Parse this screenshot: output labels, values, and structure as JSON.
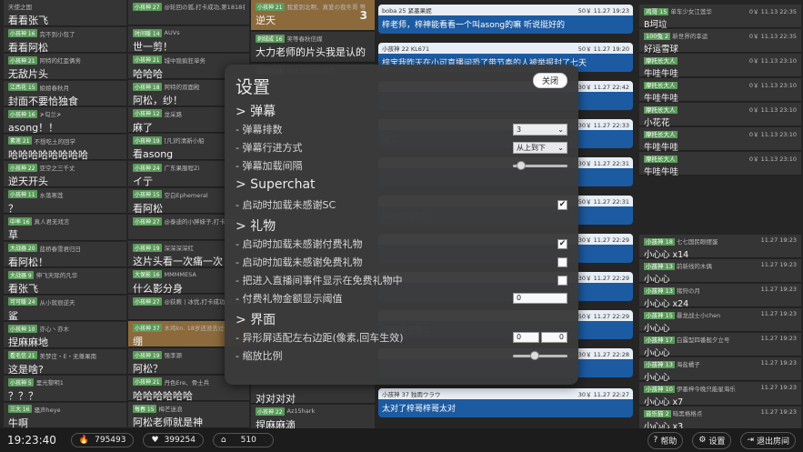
{
  "col1": [
    {
      "u": "天使之国",
      "t": "看看张飞"
    },
    {
      "u": "完不到小包了",
      "b": "小孩神 16",
      "t": "看看阿松"
    },
    {
      "u": "阿特的红歪俩务",
      "b": "小孩神 21",
      "t": "无敌片头"
    },
    {
      "u": "娘娘春秋月",
      "b": "江西花 15",
      "t": "封面不要恰独食"
    },
    {
      "u": "≯勾兰≯",
      "b": "小孩神 16",
      "t": "asong！！"
    },
    {
      "u": "不想吃土的回学",
      "b": "素莲 21",
      "t": "哈哈哈哈哈哈哈哈"
    },
    {
      "u": "亚空之三千丈",
      "b": "小孩神 22",
      "t": "逆天开头"
    },
    {
      "u": "水落寒莲",
      "b": "小孩神 11",
      "t": "？"
    },
    {
      "u": "真人君无戏言",
      "b": "中率 16",
      "t": "草"
    },
    {
      "u": "蓝桥春雪君归日",
      "b": "大战器 20",
      "t": "看阿松！"
    },
    {
      "u": "伸飞天际的凡华",
      "b": "大战器 9",
      "t": "看张飞"
    },
    {
      "u": "从小就很逆天",
      "b": "可可暖 24",
      "t": "鲨"
    },
    {
      "u": "亦心丶亦木",
      "b": "小孩神 10",
      "t": "捏麻麻地"
    },
    {
      "u": "美梦庄・E・无尊果南",
      "b": "看毛信 21",
      "t": "这是啥?"
    },
    {
      "u": "里光黎明1",
      "b": "小孩神 5",
      "t": "？？？"
    },
    {
      "u": "骚声heye",
      "b": "三大 16",
      "t": "牛啊"
    }
  ],
  "col2": [
    {
      "u": "@轮回の狐,打卡成功,第1818名,累计打卡57天",
      "b": "小孩神 27",
      "t": ""
    },
    {
      "u": "AUVs",
      "b": "时间暖 14",
      "t": "世一剪！"
    },
    {
      "u": "城中隐疯狂单务",
      "b": "小孩神 21",
      "t": "哈哈哈"
    },
    {
      "u": "阿特的双面殿",
      "b": "小孩神 18",
      "t": "阿松，纱！"
    },
    {
      "u": "龙采路",
      "b": "小孩神 12",
      "t": "麻了"
    },
    {
      "u": "[凡]的清新小船",
      "b": "小孩神 19",
      "t": "看asong"
    },
    {
      "u": "广东果服程Zi",
      "b": "小孩神 24",
      "t": "イ亍"
    },
    {
      "u": "空白Ephemeral",
      "b": "小孩神 15",
      "t": "看阿松"
    },
    {
      "u": "@泰迪的小胖妹子,打卡成功,第1821名,累计打卡",
      "b": "小孩神 27",
      "t": ""
    },
    {
      "u": "深深深深红",
      "b": "小孩神 19",
      "t": "这片头看一次痛一次"
    },
    {
      "u": "MMMMESA",
      "b": "大保影 16",
      "t": "什么影分身"
    },
    {
      "u": "@荻蕨 | 冰优,打卡成功,第1814名,累计",
      "b": "小孩神 27",
      "t": ""
    },
    {
      "u": "木鸡kn. 18岁还没去过北京",
      "b": "小孩神 37",
      "t": "绷",
      "hl": true
    },
    {
      "u": "强李源",
      "b": "小孩神 19",
      "t": "阿松？"
    },
    {
      "u": "丹色Ere、骨士兵",
      "b": "小孩神 21",
      "t": "哈哈哈哈哈哈"
    },
    {
      "u": "梅芒迷浪",
      "b": "每春 15",
      "t": "阿松老师就是神"
    }
  ],
  "col3": [
    {
      "u": "我爱到北啊、真爱の我冬哥 等",
      "b": "小孩神 21",
      "t": "逆天",
      "hl": true,
      "badge": "3"
    },
    {
      "u": "笑等春秋信媒",
      "b": "刺绒成 16",
      "t": "大力老师的片头我是认的"
    },
    {
      "u": "晚晚怎么这么换币",
      "b": "直乐兰 21",
      "t": ""
    }
  ],
  "col3b": [
    {
      "u": "",
      "b": "",
      "t": "对对对对"
    },
    {
      "u": "Az15hark",
      "b": "小孩神 22",
      "t": "捏麻麻滴"
    }
  ],
  "sc": [
    {
      "name": "boba 25 紧墨果妮",
      "price": "50￥ 11.27 19:23",
      "msg": "梓老师，梓神能看看一个叫asong的嘛 听说挺好的"
    },
    {
      "name": "小孩神 22 KL671",
      "price": "50￥ 11.27 19:20",
      "msg": "梓宝我昨天在小可直播间恐了带节奏的人被举报封了七天"
    },
    {
      "name": "",
      "price": "30￥ 11.27 22:42",
      "msg": ""
    },
    {
      "name": "",
      "price": "30￥ 11.27 22:33",
      "msg": "谢了"
    },
    {
      "name": "",
      "price": "30￥ 11.27 22:31",
      "msg": ""
    },
    {
      "name": "",
      "price": "50￥ 11.27 22:31",
      "msg": "玩dnf的时光"
    },
    {
      "name": "",
      "price": "30￥ 11.27 22:29",
      "msg": ""
    },
    {
      "name": "",
      "price": "30￥ 11.27 22:29",
      "msg": ""
    },
    {
      "name": "",
      "price": "50￥ 11.27 22:29",
      "msg": "你脑袋也瞎么"
    },
    {
      "name": "",
      "price": "30￥ 11.27 22:28",
      "msg": ""
    },
    {
      "name": "小孩神 37 独雨ウラウ",
      "price": "30￥ 11.27 22:27",
      "msg": "太对了梓哥梓哥太对"
    }
  ],
  "gifts_top": [
    {
      "u": "单车少女江莲华",
      "b": "鸡哥 15",
      "time": "0￥ 11.13 22:35",
      "t": "B坷垃"
    },
    {
      "u": "新世界的幸运",
      "b": "100兔 2",
      "time": "0￥ 11.13 22:35",
      "t": "好运雪球"
    },
    {
      "u": "",
      "b": "摩托长大人",
      "time": "0￥ 11.13 23:10",
      "t": "牛哇牛哇"
    },
    {
      "u": "",
      "b": "摩托长大人",
      "time": "0￥ 11.13 23:10",
      "t": "牛哇牛哇"
    },
    {
      "u": "",
      "b": "摩托长大人",
      "time": "0￥ 11.13 23:10",
      "t": "小花花"
    },
    {
      "u": "",
      "b": "摩托长大人",
      "time": "0￥ 11.13 23:10",
      "t": "牛哇牛哇"
    },
    {
      "u": "",
      "b": "摩托长大人",
      "time": "0￥ 11.13 23:10",
      "t": "牛哇牛哇"
    }
  ],
  "gifts_bottom": [
    {
      "u": "七七国民眼摆蛋",
      "b": "小孩神 18",
      "time": "11.27 19:23",
      "t": "小心心 x14"
    },
    {
      "u": "前新线的木偶",
      "b": "小孩神 13",
      "time": "11.27 19:23",
      "t": "小心心"
    },
    {
      "u": "猪狩の月",
      "b": "小孩神 13",
      "time": "11.27 19:23",
      "t": "小心心 x24"
    },
    {
      "u": "暴龙战士小chen",
      "b": "小孩神 15",
      "time": "11.27 19:23",
      "t": "小心心"
    },
    {
      "u": "白露型四番舰夕立号",
      "b": "小孩神 17",
      "time": "11.27 19:23",
      "t": "小心心"
    },
    {
      "u": "海盐橘子",
      "b": "小孩神 13",
      "time": "11.27 19:23",
      "t": "小心心"
    },
    {
      "u": "伊墨梓今晚只能星海乐",
      "b": "小孩神 10",
      "time": "11.27 19:23",
      "t": "小心心 x7"
    },
    {
      "u": "暗黑格格点",
      "b": "音乐猫 2",
      "time": "11.27 19:23",
      "t": "小心心 x3"
    }
  ],
  "settings": {
    "title": "设置",
    "close": "关闭",
    "sec_danmaku": "> 弹幕",
    "row_rows": "- 弹幕排数",
    "rows_val": "3",
    "row_dir": "- 弹幕行进方式",
    "dir_val": "从上到下",
    "row_interval": "- 弹幕加载间隔",
    "interval_pct": 0.08,
    "sec_sc": "> Superchat",
    "row_sc_thanks": "- 启动时加载未感谢SC",
    "sc_thanks": true,
    "sec_gift": "> 礼物",
    "row_paid": "- 启动时加载未感谢付费礼物",
    "paid": true,
    "row_free": "- 启动时加载未感谢免费礼物",
    "free": false,
    "row_enter": "- 把进入直播间事件显示在免费礼物中",
    "enter": false,
    "row_threshold": "- 付费礼物金额显示阈值",
    "threshold": "0",
    "sec_ui": "> 界面",
    "row_margin": "- 异形屏适配左右边距(像素,回车生效)",
    "margin_l": "0",
    "margin_r": "0",
    "row_scale": "- 缩放比例",
    "scale_pct": 0.38
  },
  "status": {
    "time": "19:23:40",
    "hot": "795493",
    "likes": "399254",
    "viewers": "510"
  },
  "buttons": {
    "help": "帮助",
    "settings": "设置",
    "exit": "退出房间"
  }
}
